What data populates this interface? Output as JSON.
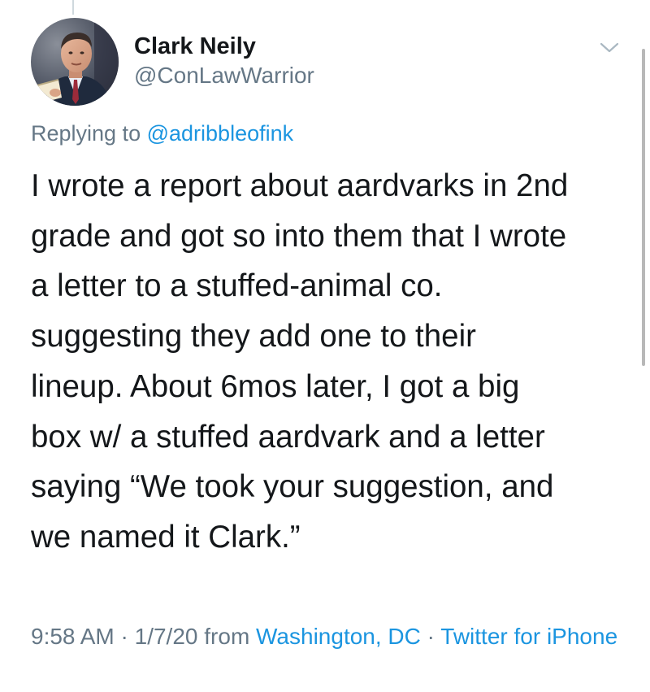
{
  "tweet": {
    "author": {
      "display_name": "Clark Neily",
      "handle": "@ConLawWarrior"
    },
    "reply_prefix": "Replying to",
    "reply_to": "@adribbleofink",
    "text_lines": [
      "I wrote a report about aardvarks in 2nd",
      "grade and got so into them that I wrote",
      "a letter to a stuffed-animal co.",
      "suggesting they add one to their",
      "lineup. About 6mos later, I got a big",
      "box w/ a stuffed aardvark and a letter",
      "saying “We took your suggestion, and",
      "we named it Clark.”"
    ],
    "meta": {
      "time": "9:58 AM",
      "date": "1/7/20",
      "separator": " · ",
      "from_label": " from ",
      "location": "Washington, DC",
      "source": "Twitter for iPhone"
    }
  },
  "icons": {
    "caret": "chevron-down-icon"
  },
  "colors": {
    "text_primary": "#14171a",
    "text_secondary": "#657786",
    "link": "#1b95e0"
  }
}
